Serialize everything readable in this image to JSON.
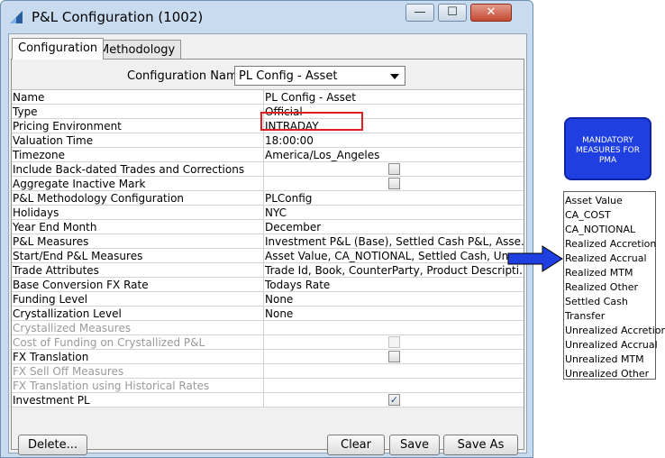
{
  "window": {
    "title": "P&L Configuration (1002)",
    "min_glyph": "—",
    "max_glyph": "☐",
    "close_glyph": "✕"
  },
  "tabs": [
    {
      "label": "Configuration"
    },
    {
      "label": "Methodology"
    }
  ],
  "config_name": {
    "label": "Configuration Name",
    "value": "PL Config - Asset"
  },
  "rows": [
    {
      "label": "Name",
      "value": "PL Config - Asset"
    },
    {
      "label": "Type",
      "value": "Official"
    },
    {
      "label": "Pricing Environment",
      "value": "INTRADAY"
    },
    {
      "label": "Valuation Time",
      "value": "18:00:00"
    },
    {
      "label": "Timezone",
      "value": "America/Los_Angeles"
    },
    {
      "label": "Include Back-dated Trades and Corrections",
      "value": ""
    },
    {
      "label": "Aggregate Inactive Mark",
      "value": ""
    },
    {
      "label": "P&L Methodology Configuration",
      "value": "PLConfig"
    },
    {
      "label": "Holidays",
      "value": "NYC"
    },
    {
      "label": "Year End Month",
      "value": "December"
    },
    {
      "label": "P&L Measures",
      "value": "Investment P&L (Base), Settled Cash P&L, Asse..."
    },
    {
      "label": "Start/End P&L Measures",
      "value": "Asset Value, CA_NOTIONAL, Settled Cash, Uns..."
    },
    {
      "label": "Trade Attributes",
      "value": "Trade Id, Book, CounterParty, Product Descripti..."
    },
    {
      "label": "Base Conversion FX Rate",
      "value": "Todays Rate"
    },
    {
      "label": "Funding Level",
      "value": "None"
    },
    {
      "label": "Crystallization Level",
      "value": "None"
    },
    {
      "label": "Crystallized Measures",
      "value": ""
    },
    {
      "label": "Cost of Funding on Crystallized P&L",
      "value": ""
    },
    {
      "label": "FX Translation",
      "value": ""
    },
    {
      "label": "FX Sell Off Measures",
      "value": ""
    },
    {
      "label": "FX Translation using Historical Rates",
      "value": ""
    },
    {
      "label": "Investment PL",
      "value": ""
    }
  ],
  "checkboxes": {
    "include_backdated": false,
    "aggregate_inactive": false,
    "cost_of_funding": false,
    "fx_translation": false,
    "investment_pl": true,
    "check_glyph": "✓"
  },
  "buttons": {
    "delete": "Delete...",
    "clear": "Clear",
    "save": "Save",
    "save_as": "Save As"
  },
  "mandatory_box": {
    "line1": "MANDATORY",
    "line2": "MEASURES FOR",
    "line3": "PMA"
  },
  "mandatory_list": [
    "Asset Value",
    "CA_COST",
    "CA_NOTIONAL",
    "Realized Accretion",
    "Realized Accrual",
    "Realized MTM",
    "Realized Other",
    "Settled Cash",
    "Transfer",
    "Unrealized Accretion",
    "Unrealized Accrual",
    "Unrealized MTM",
    "Unrealized Other"
  ],
  "colors": {
    "highlight_border": "#e02020",
    "mandatory_bg": "#1f3fe0",
    "arrow": "#1f3fe0"
  }
}
